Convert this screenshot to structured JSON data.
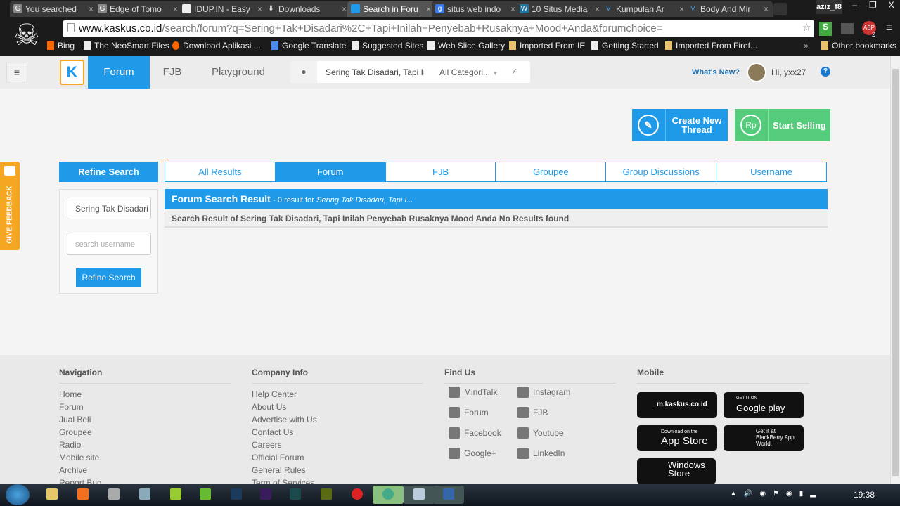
{
  "browser": {
    "tabs": [
      {
        "title": "You searched",
        "icon": "g-icon"
      },
      {
        "title": "Edge of Tomo",
        "icon": "g-icon"
      },
      {
        "title": "IDUP.IN - Easy",
        "icon": "page-icon"
      },
      {
        "title": "Downloads",
        "icon": "download-icon"
      },
      {
        "title": "Search in Foru",
        "icon": "kaskus-icon",
        "active": true
      },
      {
        "title": "situs web indo",
        "icon": "google-icon"
      },
      {
        "title": "10 Situs Media",
        "icon": "wordpress-icon"
      },
      {
        "title": "Kumpulan Ar",
        "icon": "v-icon"
      },
      {
        "title": "Body And Mir",
        "icon": "v-icon"
      }
    ],
    "user": "aziz_f8",
    "url_host": "www.kaskus.co.id",
    "url_path": "/search/forum?q=Sering+Tak+Disadari%2C+Tapi+Inilah+Penyebab+Rusaknya+Mood+Anda&forumchoice=",
    "extension_badge": "2",
    "bookmarks": [
      "Bing",
      "The NeoSmart Files",
      "Download Aplikasi ...",
      "Google Translate",
      "Suggested Sites",
      "Web Slice Gallery",
      "Imported From IE",
      "Getting Started",
      "Imported From Firef..."
    ],
    "other_bookmarks": "Other bookmarks"
  },
  "header": {
    "nav": [
      "Forum",
      "FJB",
      "Playground"
    ],
    "search_value": "Sering Tak Disadari, Tapi In",
    "category": "All Categori...",
    "whats_new": "What's New?",
    "greeting": "Hi, yxx27",
    "help": "?"
  },
  "actions": {
    "create": "Create New Thread",
    "sell": "Start Selling",
    "sell_icon_text": "Rp"
  },
  "feedback": "GIVE FEEDBACK",
  "refine": {
    "title": "Refine Search",
    "query_value": "Sering Tak Disadari",
    "username_placeholder": "search username",
    "button": "Refine Search"
  },
  "result_tabs": [
    "All Results",
    "Forum",
    "FJB",
    "Groupee",
    "Group Discussions",
    "Username"
  ],
  "result": {
    "title": "Forum Search Result",
    "count": "- 0 result for",
    "query": "Sering Tak Disadari, Tapi I...",
    "message": "Search Result of Sering Tak Disadari, Tapi Inilah Penyebab Rusaknya Mood Anda No Results found"
  },
  "footer": {
    "navigation": {
      "title": "Navigation",
      "links": [
        "Home",
        "Forum",
        "Jual Beli",
        "Groupee",
        "Radio",
        "Mobile site",
        "Archive",
        "Report Bug"
      ]
    },
    "company": {
      "title": "Company Info",
      "links": [
        "Help Center",
        "About Us",
        "Advertise with Us",
        "Contact Us",
        "Careers",
        "Official Forum",
        "General Rules",
        "Term of Services"
      ]
    },
    "find_us": {
      "title": "Find Us",
      "links": [
        "MindTalk",
        "Instagram",
        "Forum",
        "FJB",
        "Facebook",
        "Youtube",
        "Google+",
        "LinkedIn"
      ]
    },
    "mobile": {
      "title": "Mobile",
      "badges": [
        "m.kaskus.co.id",
        "GET IT ON",
        "Google play",
        "Download on the",
        "App Store",
        "Get it at",
        "BlackBerry App World.",
        "Windows",
        "Store"
      ]
    }
  },
  "taskbar": {
    "clock": "19:38"
  }
}
